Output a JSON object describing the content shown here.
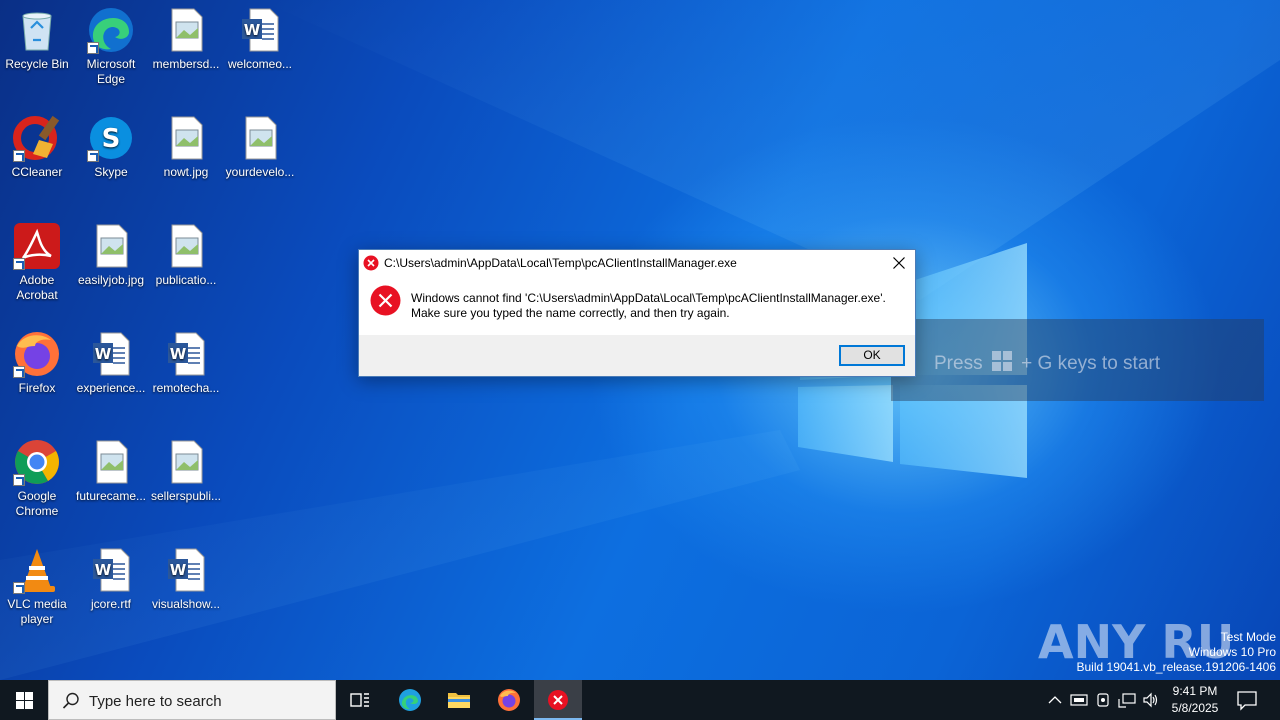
{
  "desktop": {
    "icons": [
      {
        "label": "Recycle Bin",
        "icon": "recycle-bin-icon"
      },
      {
        "label": "Microsoft Edge",
        "icon": "edge-icon"
      },
      {
        "label": "membersd...",
        "icon": "image-file-icon"
      },
      {
        "label": "welcomeo...",
        "icon": "word-doc-icon"
      },
      {
        "label": "CCleaner",
        "icon": "ccleaner-icon"
      },
      {
        "label": "Skype",
        "icon": "skype-icon"
      },
      {
        "label": "nowt.jpg",
        "icon": "image-file-icon"
      },
      {
        "label": "yourdevelo...",
        "icon": "image-file-icon"
      },
      {
        "label": "Adobe Acrobat",
        "icon": "acrobat-icon"
      },
      {
        "label": "easilyjob.jpg",
        "icon": "image-file-icon"
      },
      {
        "label": "publicatio...",
        "icon": "image-file-icon"
      },
      {
        "label": "Firefox",
        "icon": "firefox-icon"
      },
      {
        "label": "experience...",
        "icon": "word-doc-icon"
      },
      {
        "label": "remotecha...",
        "icon": "word-doc-icon"
      },
      {
        "label": "Google Chrome",
        "icon": "chrome-icon"
      },
      {
        "label": "futurecame...",
        "icon": "image-file-icon"
      },
      {
        "label": "sellerspubli...",
        "icon": "image-file-icon"
      },
      {
        "label": "VLC media player",
        "icon": "vlc-icon"
      },
      {
        "label": "jcore.rtf",
        "icon": "word-doc-icon"
      },
      {
        "label": "visualshow...",
        "icon": "word-doc-icon"
      }
    ]
  },
  "dialog": {
    "title": "C:\\Users\\admin\\AppData\\Local\\Temp\\pcAClientInstallManager.exe",
    "message_line1": "Windows cannot find 'C:\\Users\\admin\\AppData\\Local\\Temp\\pcAClientInstallManager.exe'.",
    "message_line2": "Make sure you typed the name correctly, and then try again.",
    "ok_label": "OK"
  },
  "gamebar_hint": {
    "before": "Press",
    "after": "+ G keys to start"
  },
  "watermark": {
    "line1": "Test Mode",
    "line2": "Windows 10 Pro",
    "line3": "Build 19041.vb_release.191206-1406",
    "brand": "ANY RUN"
  },
  "taskbar": {
    "search_placeholder": "Type here to search",
    "time": "9:41 PM",
    "date": "5/8/2025"
  },
  "colors": {
    "error_red": "#e81123",
    "accent": "#0078d7",
    "taskbar": "#101820"
  }
}
